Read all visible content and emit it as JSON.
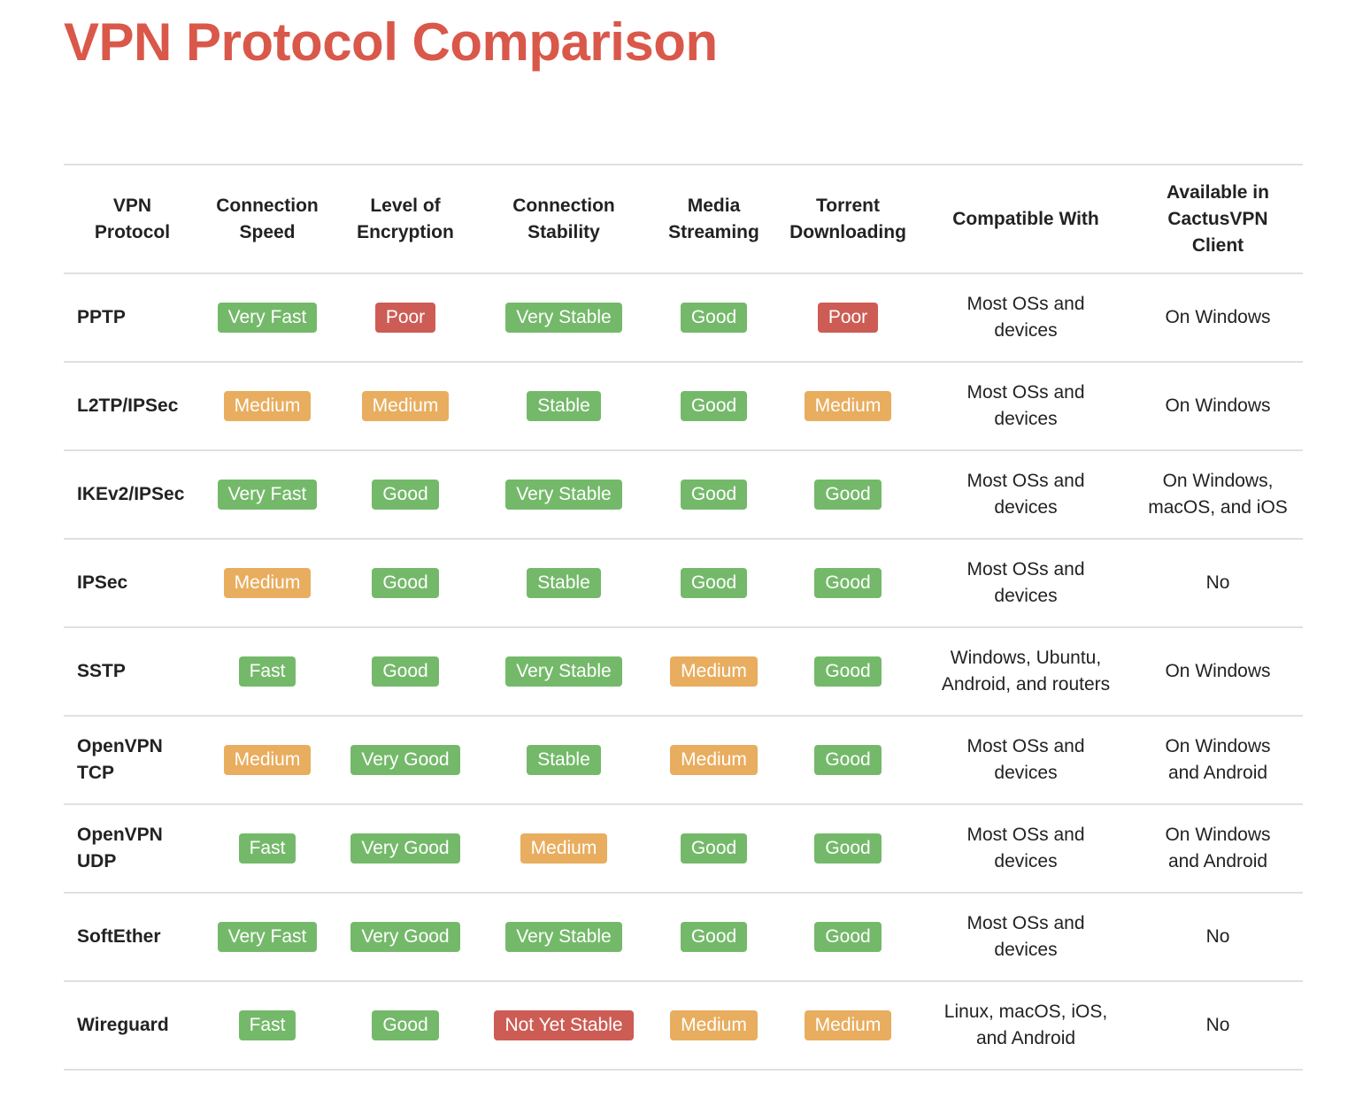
{
  "title": "VPN Protocol Comparison",
  "colors": {
    "title": "#d9584a",
    "good": "#74b96a",
    "medium": "#e8ad5e",
    "poor": "#cd5c55",
    "divider": "#e0e0e0"
  },
  "table": {
    "headers": [
      "VPN\nProtocol",
      "Connection\nSpeed",
      "Level of\nEncryption",
      "Connection\nStability",
      "Media\nStreaming",
      "Torrent\nDownloading",
      "Compatible With",
      "Available in\nCactusVPN\nClient"
    ],
    "rows": [
      {
        "protocol": "PPTP",
        "speed": {
          "label": "Very Fast",
          "level": "good"
        },
        "encryption": {
          "label": "Poor",
          "level": "poor"
        },
        "stability": {
          "label": "Very Stable",
          "level": "good"
        },
        "streaming": {
          "label": "Good",
          "level": "good"
        },
        "torrent": {
          "label": "Poor",
          "level": "poor"
        },
        "compatible": "Most OSs and\ndevices",
        "available": "On Windows"
      },
      {
        "protocol": "L2TP/IPSec",
        "speed": {
          "label": "Medium",
          "level": "medium"
        },
        "encryption": {
          "label": "Medium",
          "level": "medium"
        },
        "stability": {
          "label": "Stable",
          "level": "good"
        },
        "streaming": {
          "label": "Good",
          "level": "good"
        },
        "torrent": {
          "label": "Medium",
          "level": "medium"
        },
        "compatible": "Most OSs and\ndevices",
        "available": "On Windows"
      },
      {
        "protocol": "IKEv2/IPSec",
        "speed": {
          "label": "Very Fast",
          "level": "good"
        },
        "encryption": {
          "label": "Good",
          "level": "good"
        },
        "stability": {
          "label": "Very Stable",
          "level": "good"
        },
        "streaming": {
          "label": "Good",
          "level": "good"
        },
        "torrent": {
          "label": "Good",
          "level": "good"
        },
        "compatible": "Most OSs and\ndevices",
        "available": "On Windows,\nmacOS, and iOS"
      },
      {
        "protocol": "IPSec",
        "speed": {
          "label": "Medium",
          "level": "medium"
        },
        "encryption": {
          "label": "Good",
          "level": "good"
        },
        "stability": {
          "label": "Stable",
          "level": "good"
        },
        "streaming": {
          "label": "Good",
          "level": "good"
        },
        "torrent": {
          "label": "Good",
          "level": "good"
        },
        "compatible": "Most OSs and\ndevices",
        "available": "No"
      },
      {
        "protocol": "SSTP",
        "speed": {
          "label": "Fast",
          "level": "good"
        },
        "encryption": {
          "label": "Good",
          "level": "good"
        },
        "stability": {
          "label": "Very Stable",
          "level": "good"
        },
        "streaming": {
          "label": "Medium",
          "level": "medium"
        },
        "torrent": {
          "label": "Good",
          "level": "good"
        },
        "compatible": "Windows, Ubuntu,\nAndroid, and routers",
        "available": "On Windows"
      },
      {
        "protocol": "OpenVPN\nTCP",
        "speed": {
          "label": "Medium",
          "level": "medium"
        },
        "encryption": {
          "label": "Very Good",
          "level": "good"
        },
        "stability": {
          "label": "Stable",
          "level": "good"
        },
        "streaming": {
          "label": "Medium",
          "level": "medium"
        },
        "torrent": {
          "label": "Good",
          "level": "good"
        },
        "compatible": "Most OSs and\ndevices",
        "available": "On Windows\nand Android"
      },
      {
        "protocol": "OpenVPN\nUDP",
        "speed": {
          "label": "Fast",
          "level": "good"
        },
        "encryption": {
          "label": "Very Good",
          "level": "good"
        },
        "stability": {
          "label": "Medium",
          "level": "medium"
        },
        "streaming": {
          "label": "Good",
          "level": "good"
        },
        "torrent": {
          "label": "Good",
          "level": "good"
        },
        "compatible": "Most OSs and\ndevices",
        "available": "On Windows\nand Android"
      },
      {
        "protocol": "SoftEther",
        "speed": {
          "label": "Very Fast",
          "level": "good"
        },
        "encryption": {
          "label": "Very Good",
          "level": "good"
        },
        "stability": {
          "label": "Very Stable",
          "level": "good"
        },
        "streaming": {
          "label": "Good",
          "level": "good"
        },
        "torrent": {
          "label": "Good",
          "level": "good"
        },
        "compatible": "Most OSs and\ndevices",
        "available": "No"
      },
      {
        "protocol": "Wireguard",
        "speed": {
          "label": "Fast",
          "level": "good"
        },
        "encryption": {
          "label": "Good",
          "level": "good"
        },
        "stability": {
          "label": "Not Yet Stable",
          "level": "poor"
        },
        "streaming": {
          "label": "Medium",
          "level": "medium"
        },
        "torrent": {
          "label": "Medium",
          "level": "medium"
        },
        "compatible": "Linux, macOS, iOS,\nand Android",
        "available": "No"
      }
    ]
  }
}
